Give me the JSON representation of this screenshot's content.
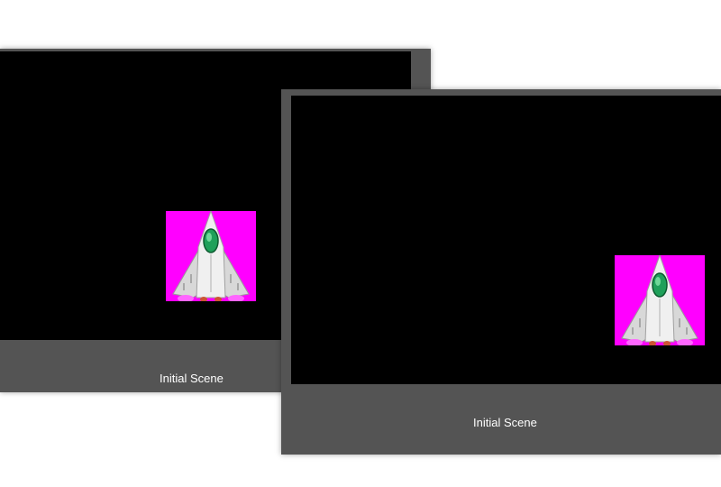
{
  "windows": [
    {
      "caption": "Initial Scene"
    },
    {
      "caption": "Initial Scene"
    }
  ],
  "sprite": {
    "icon": "spaceship-icon",
    "background_color": "#ff00ff",
    "hull_color": "#e8e8e8",
    "cockpit_color": "#1fa05a"
  },
  "colors": {
    "window_frame": "#545454",
    "viewport": "#000000",
    "caption_text": "#ffffff"
  }
}
